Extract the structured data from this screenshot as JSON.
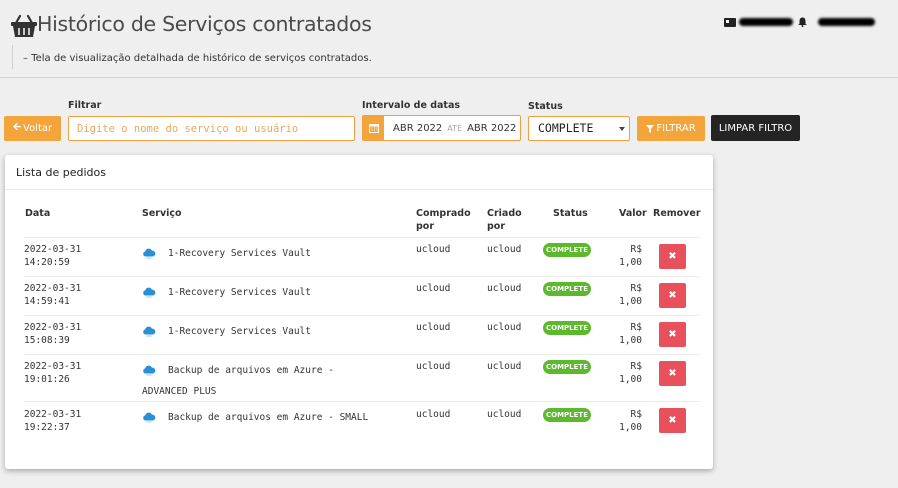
{
  "header": {
    "title": "Histórico de Serviços contratados",
    "subtitle": "Tela de visualização detalhada de histórico de serviços contratados."
  },
  "filters": {
    "back_label": "Voltar",
    "filter_label": "Filtrar",
    "search_placeholder": "Digite o nome do serviço ou usuário",
    "date_label": "Intervalo de datas",
    "date_start": "ABR 2022",
    "date_sep": "ATÉ",
    "date_end": "ABR 2022",
    "status_label": "Status",
    "status_value": "COMPLETE",
    "filter_button": "FILTRAR",
    "clear_button": "LIMPAR FILTRO"
  },
  "card": {
    "title": "Lista de pedidos",
    "columns": {
      "date": "Data",
      "service": "Serviço",
      "bought_by_1": "Comprado",
      "bought_by_2": "por",
      "created_by_1": "Criado",
      "created_by_2": "por",
      "status": "Status",
      "value": "Valor",
      "remove": "Remover"
    },
    "rows": [
      {
        "date": "2022-03-31",
        "time": "14:20:59",
        "service": "1-Recovery Services Vault",
        "service2": "",
        "bought": "ucloud",
        "created": "ucloud",
        "status": "COMPLETE",
        "currency": "R$",
        "value": "1,00"
      },
      {
        "date": "2022-03-31",
        "time": "14:59:41",
        "service": "1-Recovery Services Vault",
        "service2": "",
        "bought": "ucloud",
        "created": "ucloud",
        "status": "COMPLETE",
        "currency": "R$",
        "value": "1,00"
      },
      {
        "date": "2022-03-31",
        "time": "15:08:39",
        "service": "1-Recovery Services Vault",
        "service2": "",
        "bought": "ucloud",
        "created": "ucloud",
        "status": "COMPLETE",
        "currency": "R$",
        "value": "1,00"
      },
      {
        "date": "2022-03-31",
        "time": "19:01:26",
        "service": "Backup de arquivos em Azure -",
        "service2": "ADVANCED PLUS",
        "bought": "ucloud",
        "created": "ucloud",
        "status": "COMPLETE",
        "currency": "R$",
        "value": "1,00"
      },
      {
        "date": "2022-03-31",
        "time": "19:22:37",
        "service": "Backup de arquivos em Azure - SMALL",
        "service2": "",
        "bought": "ucloud",
        "created": "ucloud",
        "status": "COMPLETE",
        "currency": "R$",
        "value": "1,00"
      }
    ]
  },
  "colors": {
    "accent": "#f3a43a",
    "status_complete": "#5cb82c",
    "delete": "#e8505b",
    "dark_button": "#242424"
  },
  "icons": [
    "basket-icon",
    "id-card-icon",
    "bell-icon",
    "arrow-left-icon",
    "calendar-icon",
    "filter-icon",
    "cloud-icon",
    "close-icon"
  ]
}
